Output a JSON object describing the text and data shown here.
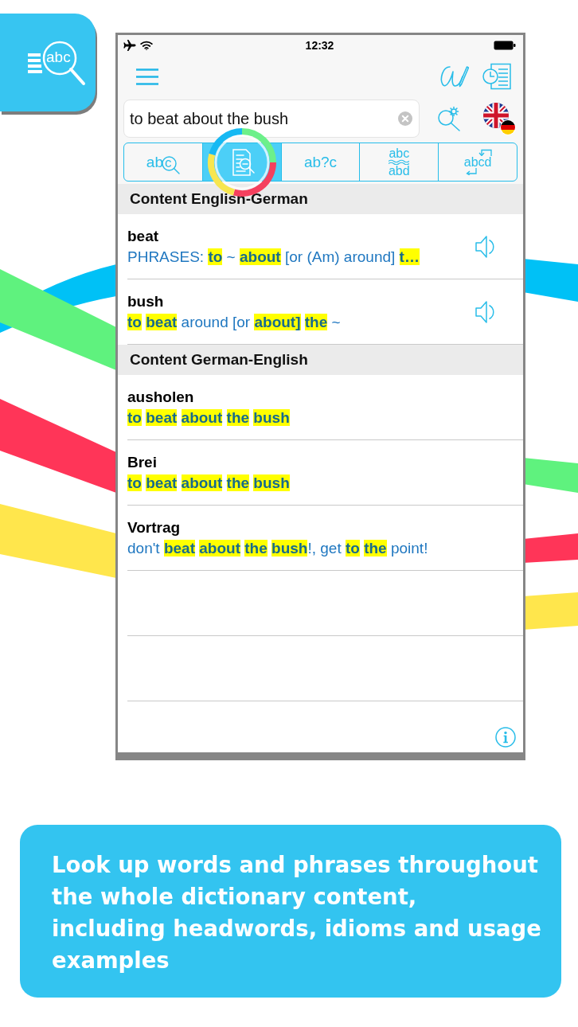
{
  "app_badge": {
    "label": "abc"
  },
  "status_bar": {
    "time": "12:32"
  },
  "search": {
    "value": "to beat about the bush"
  },
  "tabs": [
    {
      "kind": "lens",
      "text": "ab",
      "lens_text": "c",
      "selected": false
    },
    {
      "kind": "document",
      "selected": true
    },
    {
      "kind": "plain",
      "text": "ab?c",
      "selected": false
    },
    {
      "kind": "stacked",
      "text": "abc",
      "text_below": "abd",
      "selected": false
    },
    {
      "kind": "arrows",
      "text": "abcd",
      "selected": false
    }
  ],
  "sections": [
    {
      "title": "Content English-German",
      "entries": [
        {
          "headword": "beat",
          "text": "PHRASES: **to** ~ **about** [or (Am) around] **t…**",
          "audio": true
        },
        {
          "headword": "bush",
          "text": "**to** **beat** around [or **about]** **the** ~",
          "audio": true
        }
      ]
    },
    {
      "title": "Content German-English",
      "entries": [
        {
          "headword": "ausholen",
          "text": "**to** **beat** **about** **the** **bush**",
          "audio": false
        },
        {
          "headword": "Brei",
          "text": "**to** **beat** **about** **the** **bush**",
          "audio": false
        },
        {
          "headword": "Vortrag",
          "text": "don't **beat** **about** **the** **bush**!, get **to** **the** point!",
          "audio": false
        }
      ]
    }
  ],
  "banner": {
    "text": "Look up words and phrases throughout the whole dictionary content,\nincluding headwords, idioms and usage examples"
  }
}
